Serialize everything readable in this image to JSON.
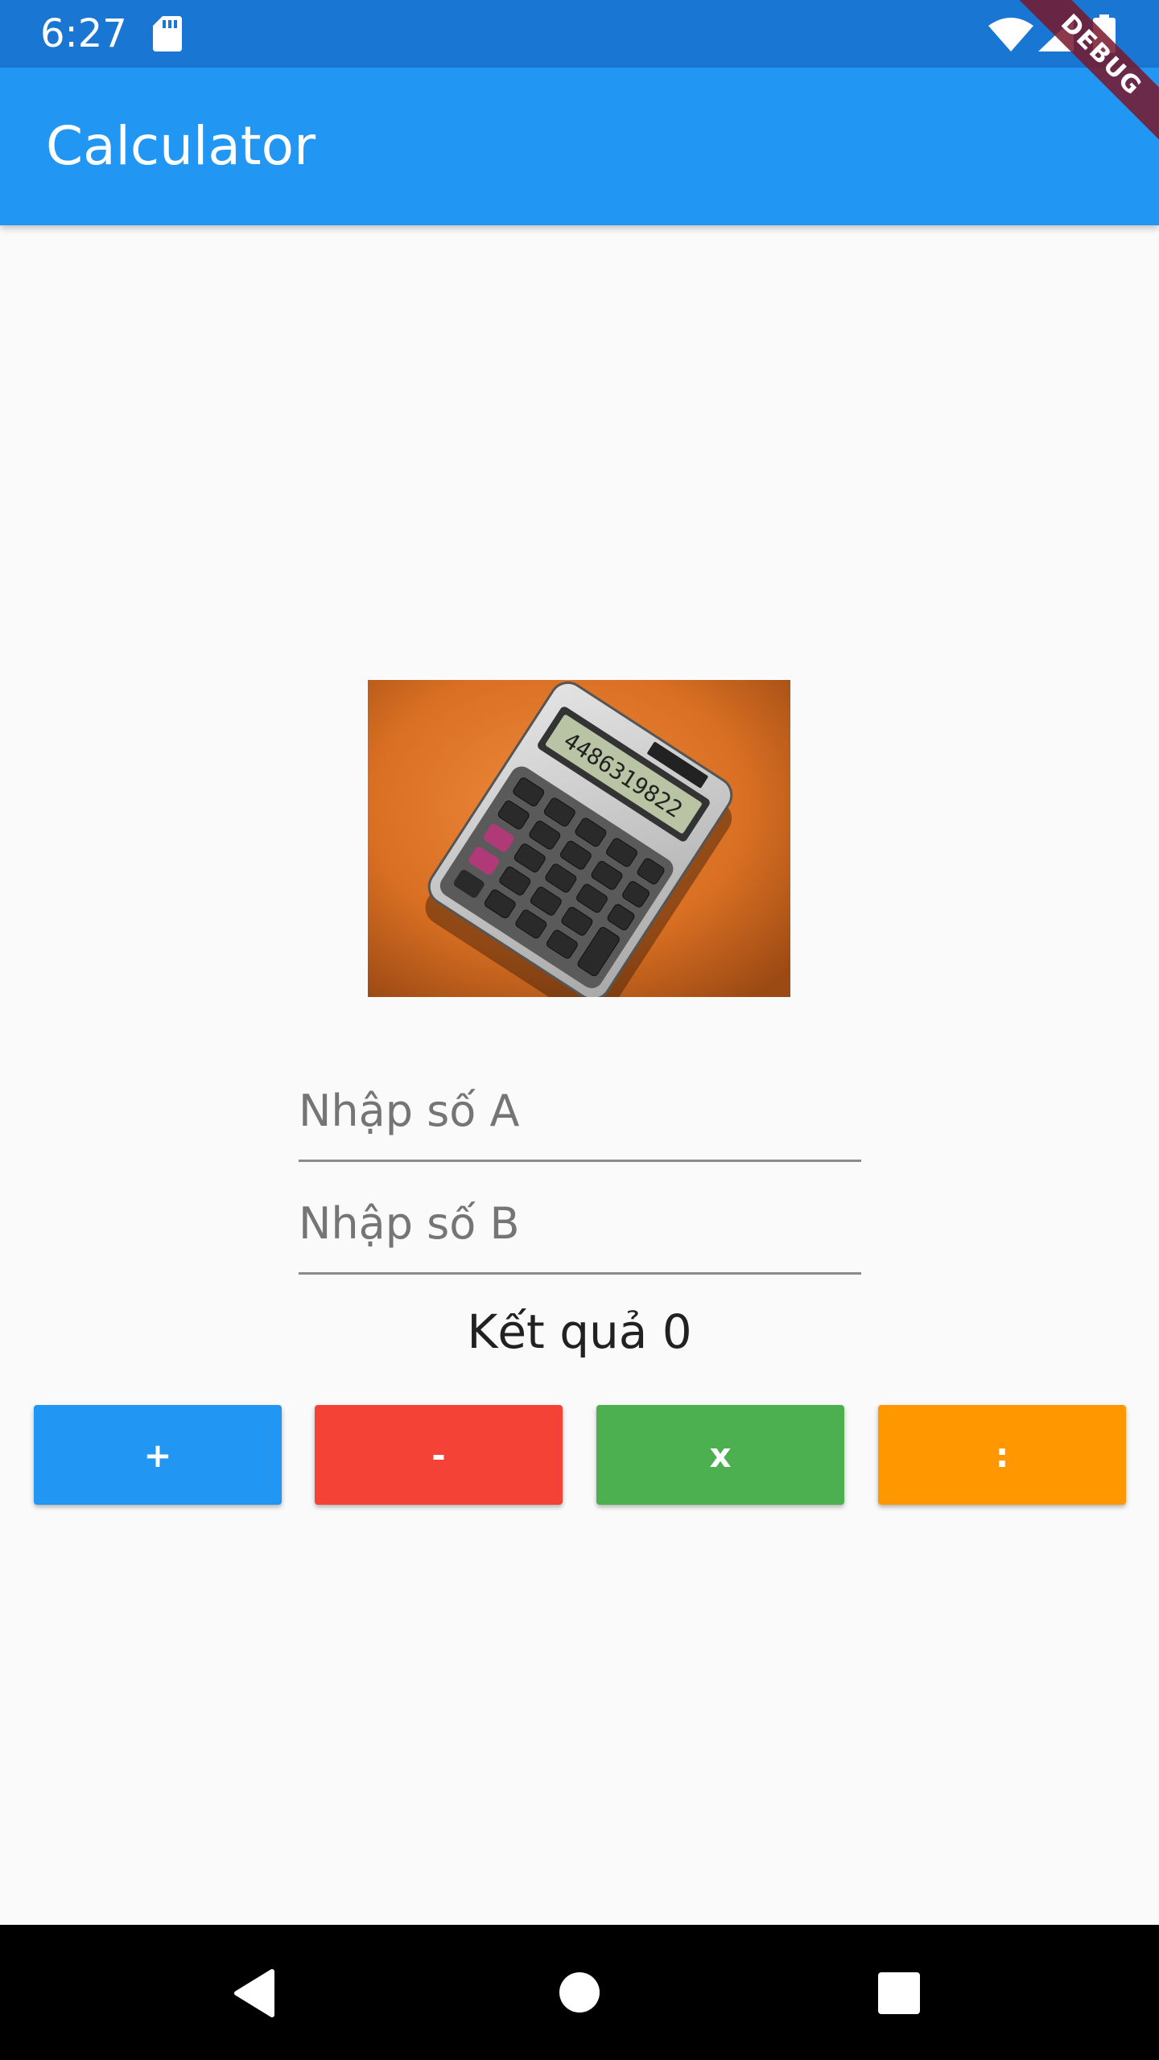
{
  "status_bar": {
    "time": "6:27",
    "icons": [
      "sd-card-icon",
      "wifi-icon",
      "signal-icon",
      "battery-icon"
    ]
  },
  "debug_banner": "DEBUG",
  "app_bar": {
    "title": "Calculator",
    "color": "#2196f3"
  },
  "image": {
    "icon": "calculator-photo"
  },
  "inputs": {
    "a": {
      "placeholder": "Nhập số A",
      "value": ""
    },
    "b": {
      "placeholder": "Nhập số B",
      "value": ""
    }
  },
  "result": {
    "text": "Kết quả 0"
  },
  "buttons": [
    {
      "label": "+",
      "color": "#2196f3"
    },
    {
      "label": "-",
      "color": "#f44336"
    },
    {
      "label": "x",
      "color": "#4caf50"
    },
    {
      "label": ":",
      "color": "#ff9800"
    }
  ],
  "nav_bar": {
    "icons": [
      "back-icon",
      "home-icon",
      "recents-icon"
    ]
  }
}
